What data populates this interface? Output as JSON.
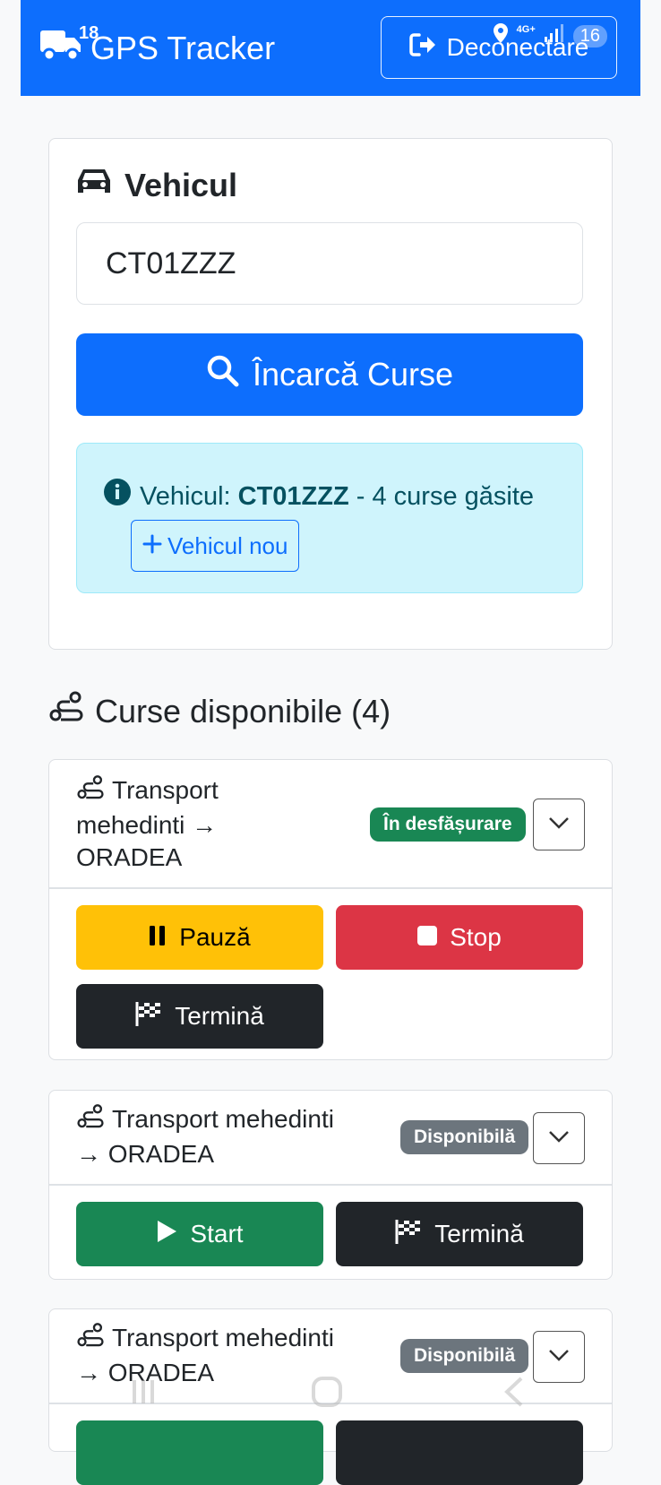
{
  "status_bar": {
    "time": "18",
    "network": "4G+",
    "battery": "16"
  },
  "navbar": {
    "brand": "GPS Tracker",
    "logout_label": "Deconectare"
  },
  "vehicle_card": {
    "title": "Vehicul",
    "input_value": "CT01ZZZ",
    "load_button": "Încarcă Curse",
    "info": {
      "prefix": "Vehicul:",
      "plate": "CT01ZZZ",
      "suffix": "- 4 curse găsite",
      "new_vehicle_button": "Vehicul nou"
    }
  },
  "trips_section": {
    "title": "Curse disponibile (4)"
  },
  "trips": [
    {
      "route_line1": "Transport",
      "route_line2": "mehedinti →",
      "route_line3": "ORADEA",
      "status": "În desfășurare",
      "actions": {
        "pause": "Pauză",
        "stop": "Stop",
        "finish": "Termină"
      }
    },
    {
      "route_line1": "Transport mehedinti",
      "route_line2": "→ ORADEA",
      "status": "Disponibilă",
      "actions": {
        "start": "Start",
        "finish": "Termină"
      }
    },
    {
      "route_line1": "Transport mehedinti",
      "route_line2": "→ ORADEA",
      "status": "Disponibilă"
    }
  ],
  "colors": {
    "primary": "#0d6efd",
    "success": "#198754",
    "warning": "#ffc107",
    "danger": "#dc3545",
    "dark": "#212529",
    "secondary": "#6c757d",
    "info_bg": "#cff4fc"
  }
}
